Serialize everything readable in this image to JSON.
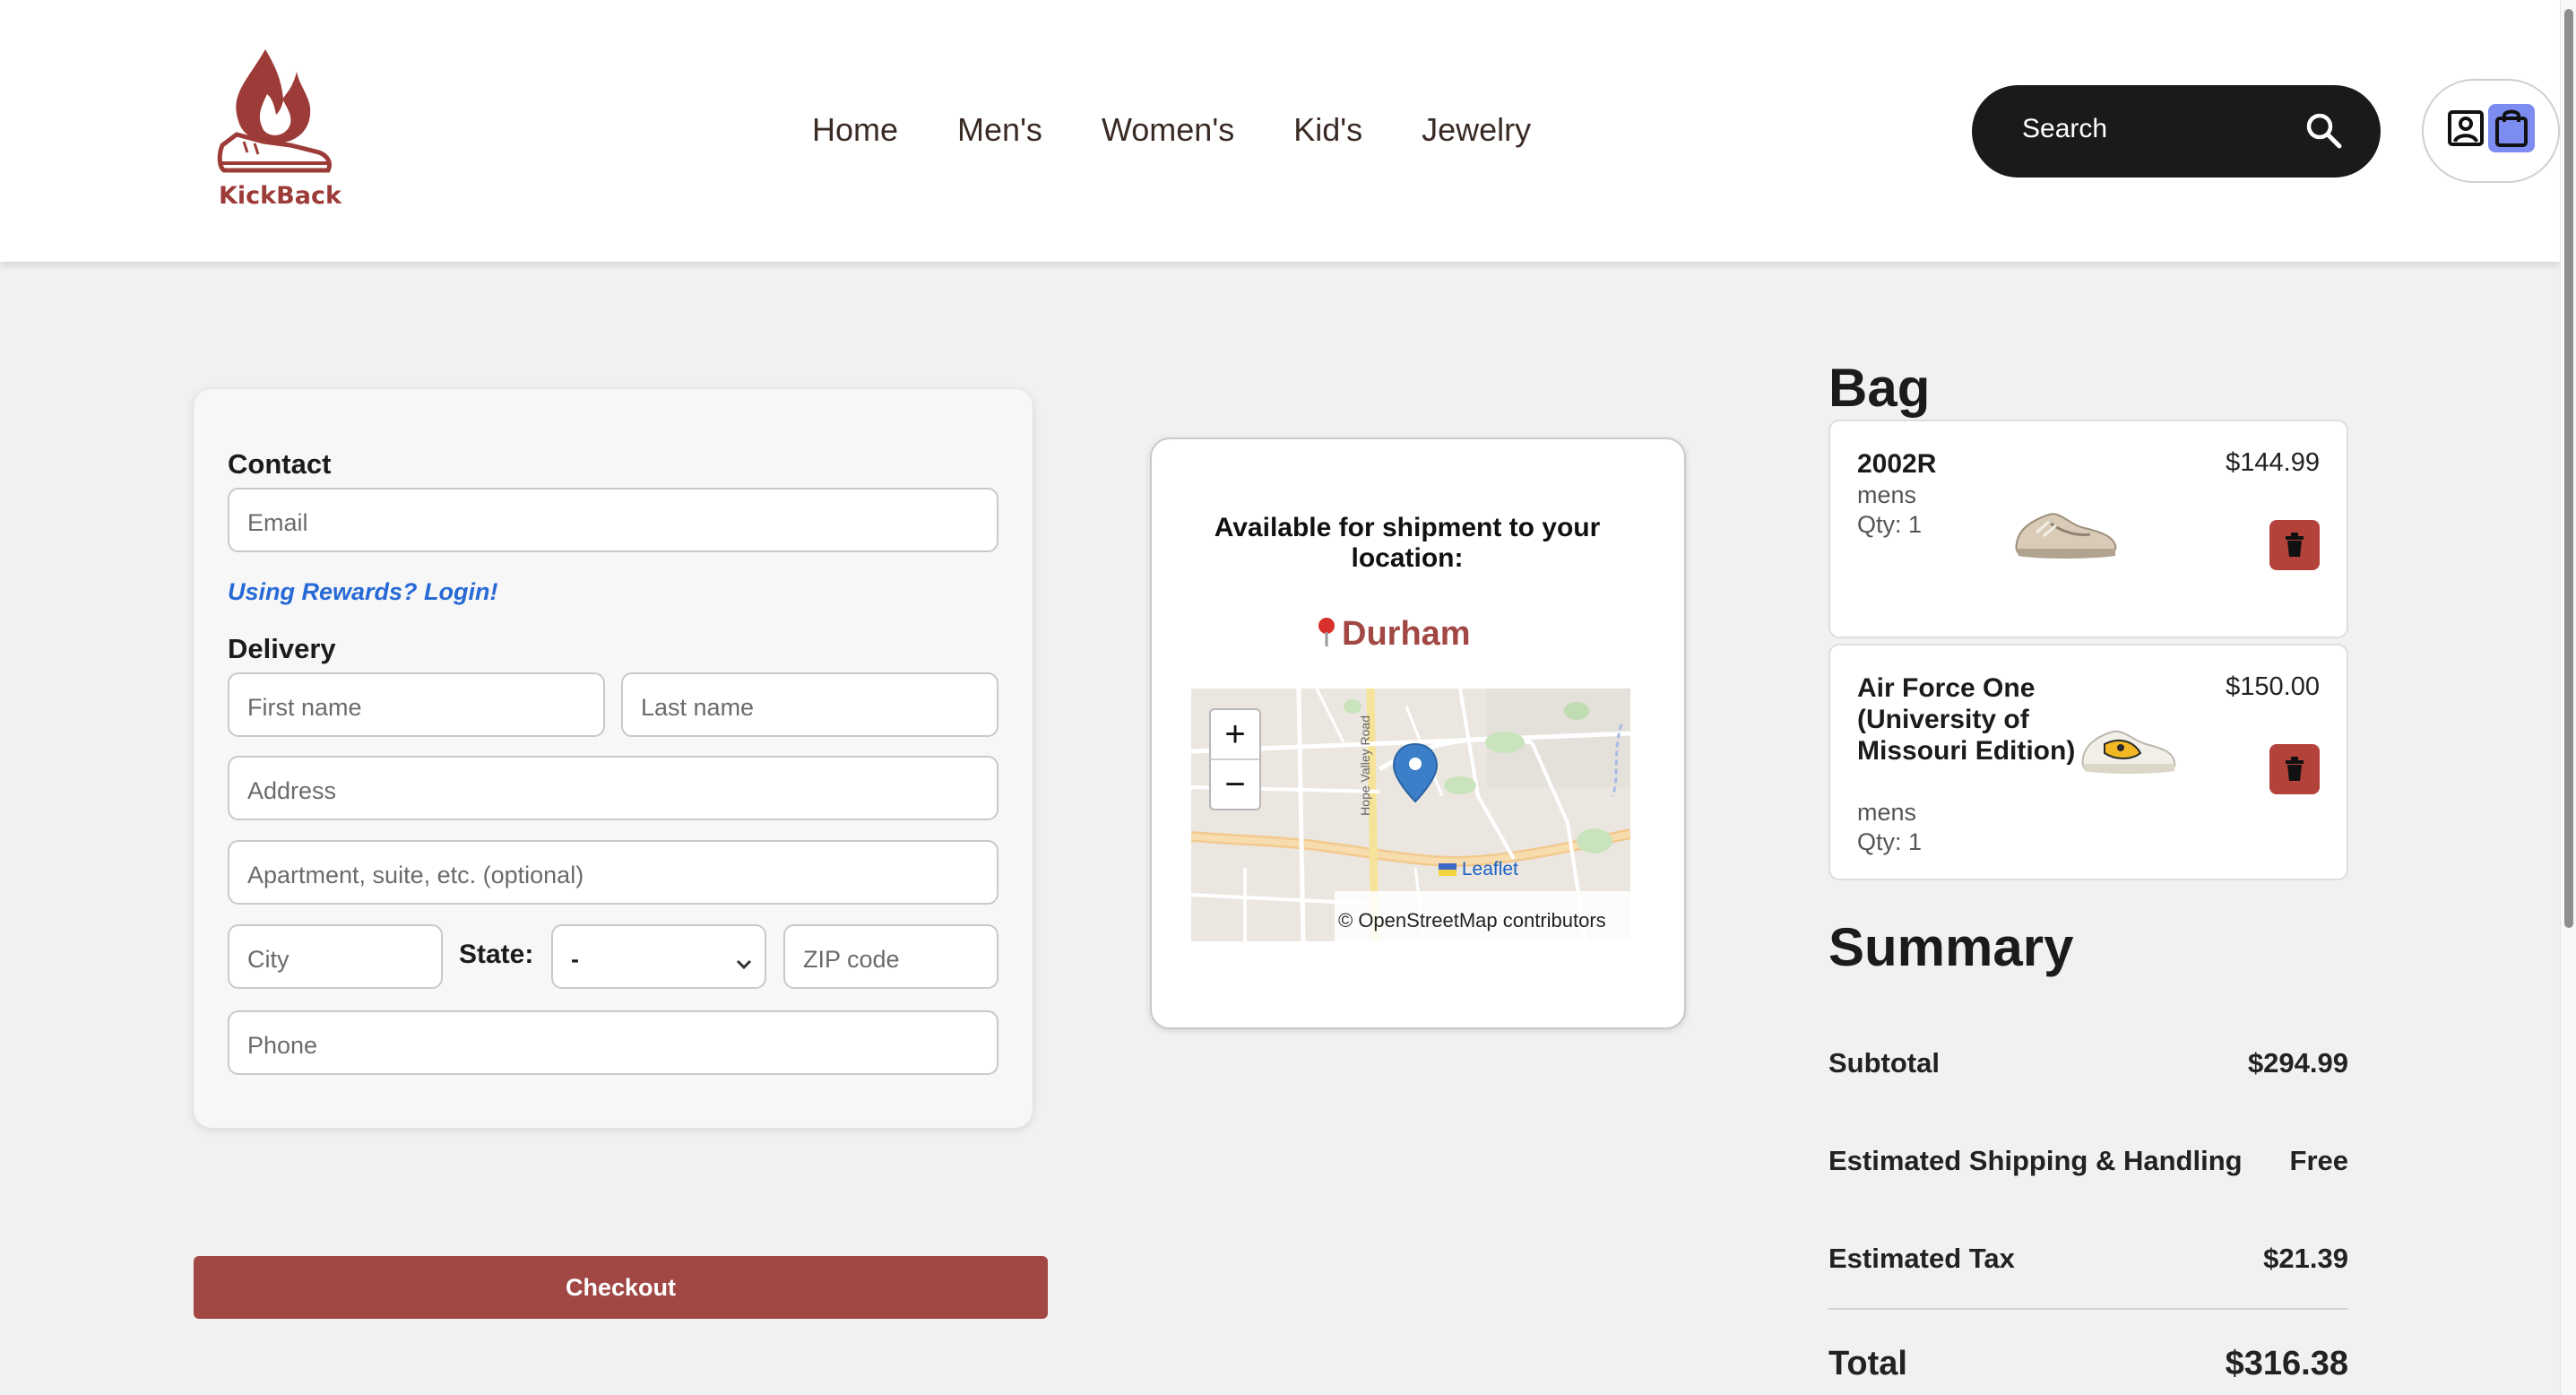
{
  "brand": {
    "name": "KickBack",
    "color": "#9c3b37"
  },
  "nav": {
    "items": [
      "Home",
      "Men's",
      "Women's",
      "Kid's",
      "Jewelry"
    ]
  },
  "search": {
    "label": "Search",
    "icon": "search-icon"
  },
  "header_icons": {
    "user": "user-profile-icon",
    "bag": "shopping-bag-icon",
    "bag_color": "#7d8cf0"
  },
  "form": {
    "contact_title": "Contact",
    "email_placeholder": "Email",
    "rewards_link": "Using Rewards? Login!",
    "delivery_title": "Delivery",
    "first_name_placeholder": "First name",
    "last_name_placeholder": "Last name",
    "address_placeholder": "Address",
    "apartment_placeholder": "Apartment, suite, etc. (optional)",
    "city_placeholder": "City",
    "state_label": "State:",
    "state_value": "-",
    "zip_placeholder": "ZIP code",
    "phone_placeholder": "Phone"
  },
  "checkout": {
    "label": "Checkout",
    "color": "#a14845"
  },
  "shipment": {
    "title": "Available for shipment to your location:",
    "city": "Durham",
    "map": {
      "zoom_in": "+",
      "zoom_out": "−",
      "attribution_leaflet": "Leaflet",
      "attribution_osm": "© OpenStreetMap contributors",
      "road_label": "Hope Valley Road"
    }
  },
  "bag": {
    "title": "Bag",
    "items": [
      {
        "name": "2002R",
        "category": "mens",
        "qty": "Qty: 1",
        "price": "$144.99"
      },
      {
        "name": "Air Force One (University of Missouri Edition)",
        "category": "mens",
        "qty": "Qty: 1",
        "price": "$150.00"
      }
    ]
  },
  "summary": {
    "title": "Summary",
    "subtotal_label": "Subtotal",
    "subtotal_value": "$294.99",
    "shipping_label": "Estimated Shipping & Handling",
    "shipping_value": "Free",
    "tax_label": "Estimated Tax",
    "tax_value": "$21.39",
    "total_label": "Total",
    "total_value": "$316.38"
  }
}
